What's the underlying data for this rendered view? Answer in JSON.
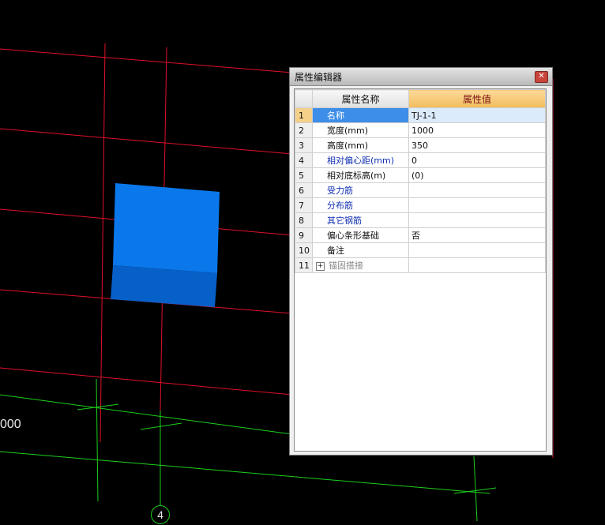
{
  "viewport": {
    "edge_label": "000",
    "axis_marker": "4"
  },
  "window": {
    "title": "属性编辑器",
    "close_icon": "close-icon"
  },
  "table": {
    "headers": {
      "name": "属性名称",
      "value": "属性值"
    },
    "rows": [
      {
        "num": "1",
        "name": "名称",
        "value": "TJ-1-1",
        "selected": true
      },
      {
        "num": "2",
        "name": "宽度(mm)",
        "value": "1000"
      },
      {
        "num": "3",
        "name": "高度(mm)",
        "value": "350"
      },
      {
        "num": "4",
        "name": "相对偏心距(mm)",
        "value": "0"
      },
      {
        "num": "5",
        "name": "相对底标高(m)",
        "value": "(0)"
      },
      {
        "num": "6",
        "name": "受力筋",
        "value": ""
      },
      {
        "num": "7",
        "name": "分布筋",
        "value": ""
      },
      {
        "num": "8",
        "name": "其它钢筋",
        "value": ""
      },
      {
        "num": "9",
        "name": "偏心条形基础",
        "value": "否"
      },
      {
        "num": "10",
        "name": "备注",
        "value": ""
      },
      {
        "num": "11",
        "name": "锚固搭接",
        "value": "",
        "expander": "+"
      }
    ]
  },
  "colors": {
    "grid_red": "#e0102a",
    "grid_green": "#1ccf1c",
    "block_front": "#0a78ea",
    "block_bottom": "#0660c8",
    "header_accent": "#f2bd5c",
    "selection": "#3d8ee8"
  }
}
